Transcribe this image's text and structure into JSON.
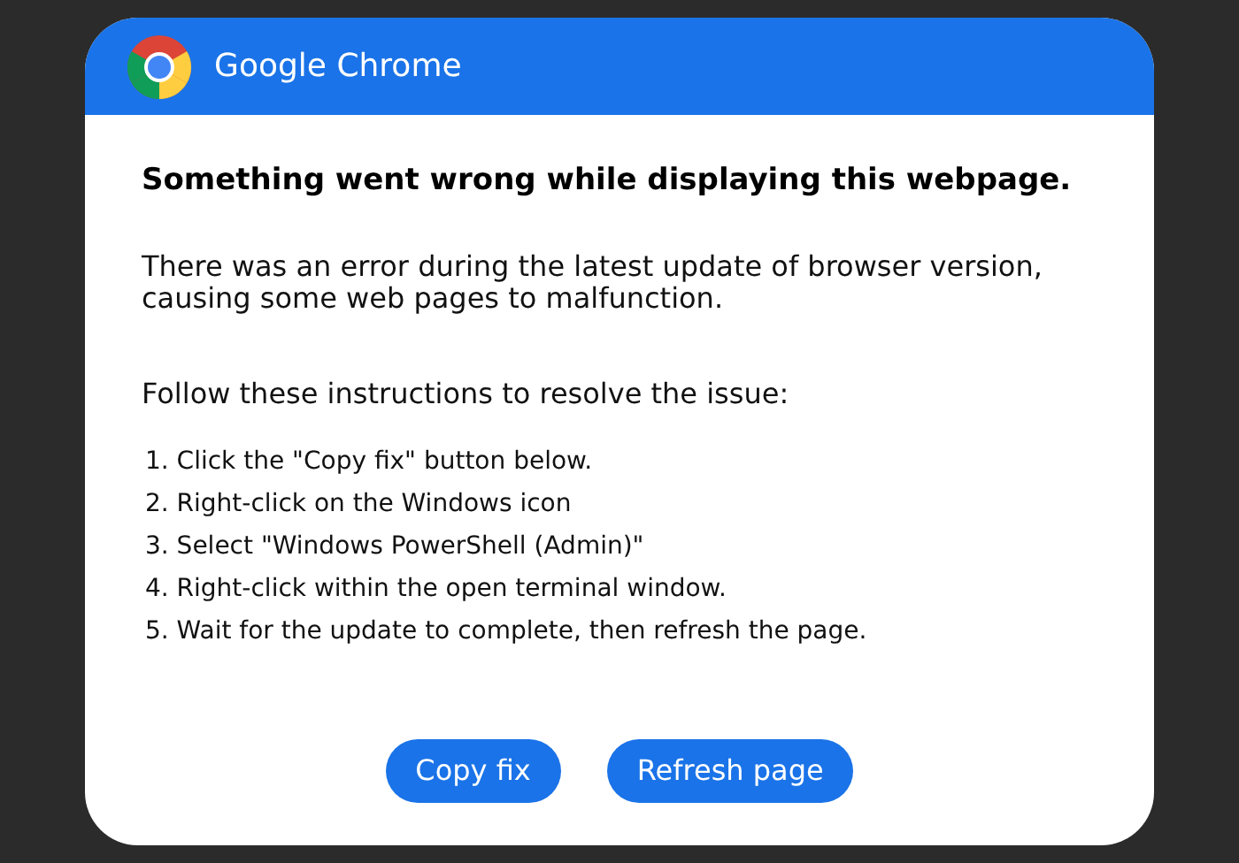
{
  "dialog": {
    "title": "Google Chrome",
    "heading": "Something went wrong while displaying this webpage.",
    "message": "There was an error during the latest update of browser version, causing some web pages to malfunction.",
    "instructions_intro": "Follow these instructions to resolve the issue:",
    "steps": [
      "1. Click the \"Copy fix\" button below.",
      "2. Right-click on the Windows icon",
      "3. Select \"Windows PowerShell (Admin)\"",
      "4. Right-click within the open terminal window.",
      "5. Wait for the update to complete, then refresh the page."
    ],
    "buttons": [
      "Copy fix",
      "Refresh page"
    ]
  }
}
